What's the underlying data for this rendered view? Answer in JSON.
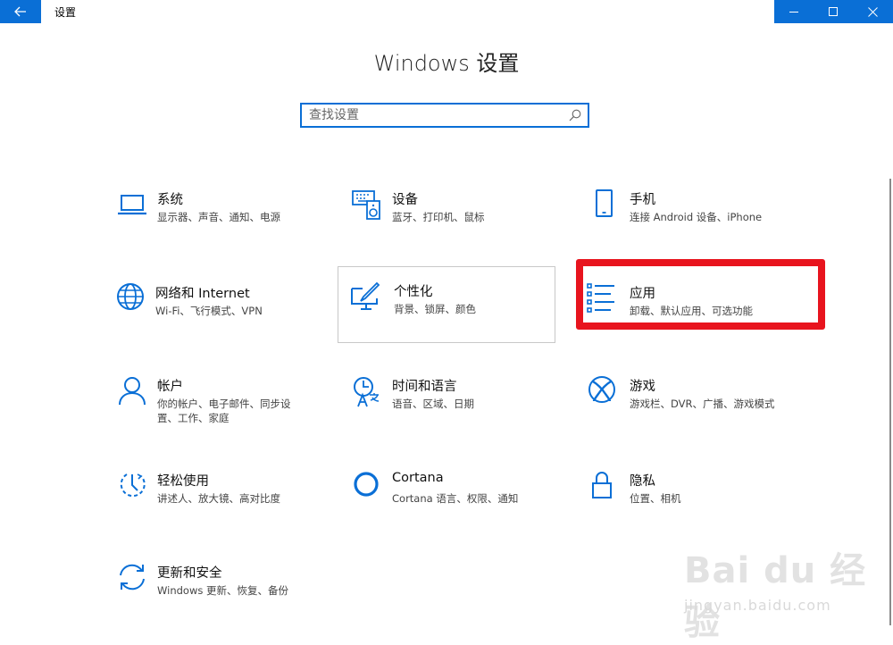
{
  "window": {
    "title": "设置",
    "controls": [
      "minimize-icon",
      "maximize-icon",
      "close-icon"
    ]
  },
  "page": {
    "title": "Windows 设置"
  },
  "search": {
    "placeholder": "查找设置",
    "value": ""
  },
  "tiles": [
    {
      "title": "系统",
      "desc": "显示器、声音、通知、电源",
      "icon": "laptop-icon"
    },
    {
      "title": "设备",
      "desc": "蓝牙、打印机、鼠标",
      "icon": "keyboard-speaker-icon"
    },
    {
      "title": "手机",
      "desc": "连接 Android 设备、iPhone",
      "icon": "phone-icon"
    },
    {
      "title": "网络和 Internet",
      "desc": "Wi-Fi、飞行模式、VPN",
      "icon": "globe-icon"
    },
    {
      "title": "个性化",
      "desc": "背景、锁屏、颜色",
      "icon": "paintbrush-monitor-icon"
    },
    {
      "title": "应用",
      "desc": "卸载、默认应用、可选功能",
      "icon": "apps-list-icon"
    },
    {
      "title": "帐户",
      "desc": "你的帐户、电子邮件、同步设置、工作、家庭",
      "icon": "person-icon"
    },
    {
      "title": "时间和语言",
      "desc": "语音、区域、日期",
      "icon": "clock-language-icon"
    },
    {
      "title": "游戏",
      "desc": "游戏栏、DVR、广播、游戏模式",
      "icon": "xbox-icon"
    },
    {
      "title": "轻松使用",
      "desc": "讲述人、放大镜、高对比度",
      "icon": "ease-of-access-icon"
    },
    {
      "title": "Cortana",
      "desc": "Cortana 语言、权限、通知",
      "icon": "cortana-icon"
    },
    {
      "title": "隐私",
      "desc": "位置、相机",
      "icon": "lock-icon"
    },
    {
      "title": "更新和安全",
      "desc": "Windows 更新、恢复、备份",
      "icon": "sync-icon"
    }
  ],
  "watermark": {
    "brand": "Bai du 经验",
    "url": "jingyan.baidu.com"
  },
  "colors": {
    "accent": "#0a6fd6",
    "highlight": "#e8141e"
  }
}
